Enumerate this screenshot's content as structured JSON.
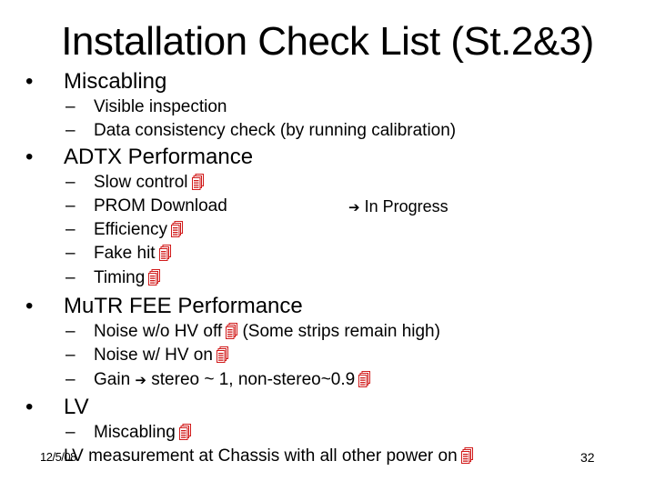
{
  "slide": {
    "title": "Installation Check List (St.2&3)",
    "sections": [
      {
        "label": "Miscabling",
        "items": [
          {
            "text": "Visible inspection",
            "has_doc_icon": false
          },
          {
            "text": "Data consistency check (by running calibration)",
            "has_doc_icon": false
          }
        ]
      },
      {
        "label": "ADTX Performance",
        "items": [
          {
            "text": "Slow control",
            "has_doc_icon": true
          },
          {
            "text": "PROM Download",
            "has_doc_icon": false
          },
          {
            "text": "Efficiency",
            "has_doc_icon": true
          },
          {
            "text": "Fake hit",
            "has_doc_icon": true
          },
          {
            "text": "Timing",
            "has_doc_icon": true
          }
        ],
        "status_note": "In Progress"
      },
      {
        "label": "MuTR FEE Performance",
        "items": [
          {
            "text": "Noise w/o HV off",
            "has_doc_icon": true,
            "suffix": "(Some strips remain high)"
          },
          {
            "text": "Noise w/ HV on",
            "has_doc_icon": true
          },
          {
            "text": "Gain",
            "arrow": true,
            "suffix": "stereo ~ 1, non-stereo~0.9",
            "has_doc_icon": true
          }
        ]
      },
      {
        "label": "LV",
        "items": [
          {
            "text": "Miscabling",
            "has_doc_icon": true
          },
          {
            "text": "LV measurement at Chassis with all other power on",
            "has_doc_icon": true
          }
        ]
      }
    ],
    "footer": {
      "date": "12/5/08",
      "page_number": "32"
    },
    "symbols": {
      "bullet": "•",
      "dash": "–",
      "arrow": "➔"
    },
    "colors": {
      "text": "#000000",
      "doc_icon": "#d11a1a",
      "background": "#ffffff"
    }
  }
}
